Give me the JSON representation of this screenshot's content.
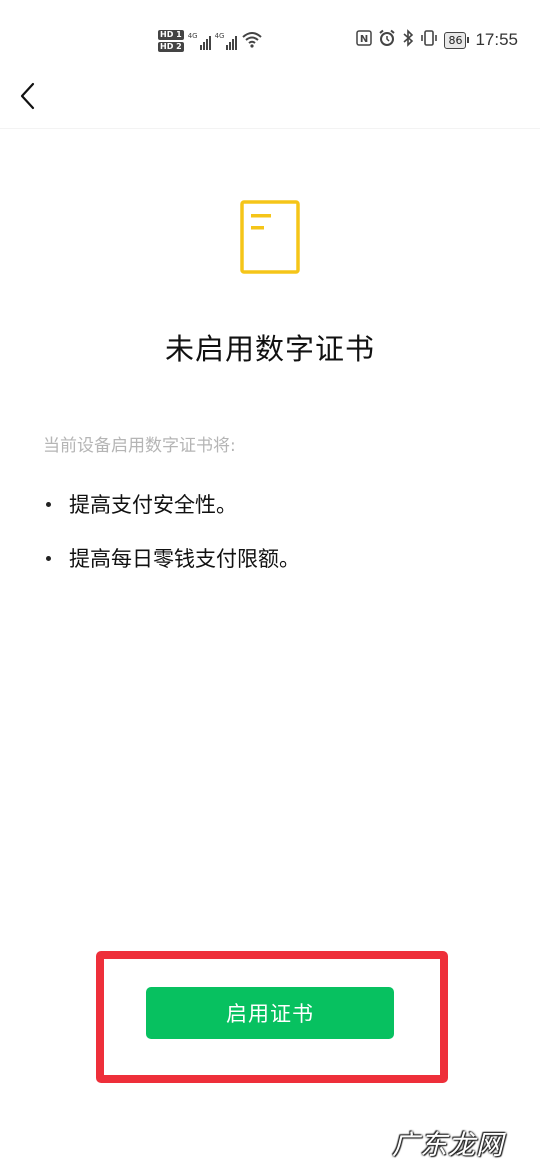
{
  "status_bar": {
    "sim1_label": "HD 1",
    "sim2_label": "HD 2",
    "network_type_1": "4G",
    "network_type_2": "4G",
    "nfc_label": "N",
    "battery_level": "86",
    "time": "17:55",
    "icons": [
      "nfc-icon",
      "alarm-icon",
      "bluetooth-icon",
      "vibrate-icon",
      "wifi-icon",
      "signal-icon"
    ]
  },
  "nav": {
    "back_icon": "chevron-left-icon"
  },
  "main": {
    "icon": "document-icon",
    "accent_color": "#f5c518",
    "title": "未启用数字证书",
    "intro": "当前设备启用数字证书将:",
    "benefits": [
      "提高支付安全性。",
      "提高每日零钱支付限额。"
    ]
  },
  "action": {
    "enable_label": "启用证书",
    "button_color": "#07c160",
    "highlight_color": "#ee2f3a"
  },
  "watermark": {
    "text": "广东龙网"
  }
}
